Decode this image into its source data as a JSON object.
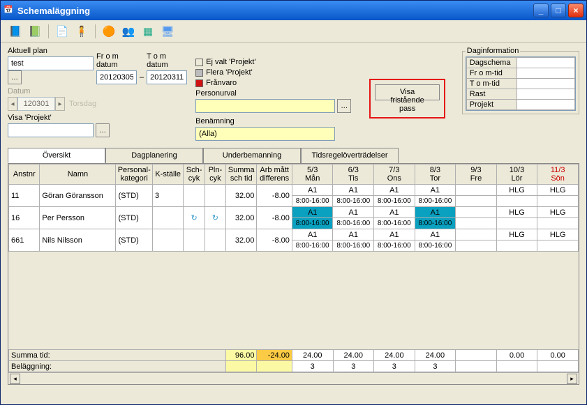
{
  "window": {
    "title": "Schemaläggning"
  },
  "labels": {
    "aktuell_plan": "Aktuell plan",
    "fromdatum": "Fr o m datum",
    "tomdatum": "T o m datum",
    "datum": "Datum",
    "personurval": "Personurval",
    "visa_projekt": "Visa 'Projekt'",
    "benamning": "Benämning",
    "daginfo": "Daginformation"
  },
  "fields": {
    "aktuell_plan": "test",
    "fromdatum": "20120305",
    "tomdatum": "20120311",
    "datum": "120301",
    "weekday": "Torsdag",
    "personurval": "",
    "visa_projekt": "",
    "benamning": "(Alla)"
  },
  "legend": {
    "ej_valt": "Ej valt 'Projekt'",
    "flera": "Flera 'Projekt'",
    "franvaro": "Frånvaro",
    "color_ej": "#ece9d8",
    "color_flera": "#bcbcbc",
    "color_fran": "#d11212"
  },
  "button_visa_pass": "Visa fristående pass",
  "daginfo_rows": {
    "dagschema": "Dagschema",
    "dagschema_v": "",
    "from": "Fr o m-tid",
    "from_v": "",
    "tom": "T o m-tid",
    "tom_v": "",
    "rast": "Rast",
    "rast_v": "",
    "projekt": "Projekt",
    "projekt_v": ""
  },
  "tabs": {
    "oversikt": "Översikt",
    "dagplanering": "Dagplanering",
    "underbemanning": "Underbemanning",
    "tidsregel": "Tidsregelöverträdelser"
  },
  "grid": {
    "headers": {
      "anstnr": "Anstnr",
      "namn": "Namn",
      "pkat": "Personal-\nkategori",
      "ksta": "K-ställe",
      "schcyk": "Sch-\ncyk",
      "plncyk": "Pln-\ncyk",
      "summa": "Summa\nsch tid",
      "diff": "Arb mått\ndifferens",
      "d0": "5/3\nMån",
      "d1": "6/3\nTis",
      "d2": "7/3\nOns",
      "d3": "8/3\nTor",
      "d4": "9/3\nFre",
      "d5": "10/3\nLör",
      "d6": "11/3\nSön"
    },
    "time": "8:00-16:00",
    "rows": [
      {
        "anstnr": "11",
        "namn": "Göran Göransson",
        "pkat": "(STD)",
        "ksta": "3",
        "sch": "",
        "pln": "",
        "summa": "32.00",
        "diff": "-8.00",
        "days": [
          "A1",
          "A1",
          "A1",
          "A1",
          "",
          "HLG",
          "HLG"
        ],
        "hl": []
      },
      {
        "anstnr": "16",
        "namn": "Per Persson",
        "pkat": "(STD)",
        "ksta": "",
        "sch": "↻",
        "pln": "↻",
        "summa": "32.00",
        "diff": "-8.00",
        "days": [
          "A1",
          "A1",
          "A1",
          "A1",
          "",
          "HLG",
          "HLG"
        ],
        "hl": [
          0,
          3
        ]
      },
      {
        "anstnr": "661",
        "namn": "Nils Nilsson",
        "pkat": "(STD)",
        "ksta": "",
        "sch": "",
        "pln": "",
        "summa": "32.00",
        "diff": "-8.00",
        "days": [
          "A1",
          "A1",
          "A1",
          "A1",
          "",
          "HLG",
          "HLG"
        ],
        "hl": []
      }
    ],
    "footer": {
      "summa_label": "Summa tid:",
      "summa": "96.00",
      "summa_diff": "-24.00",
      "bel_label": "Beläggning:",
      "day_sums": [
        "24.00",
        "24.00",
        "24.00",
        "24.00",
        "",
        "0.00",
        "0.00"
      ],
      "bel": [
        "3",
        "3",
        "3",
        "3",
        "",
        "",
        ""
      ]
    }
  }
}
